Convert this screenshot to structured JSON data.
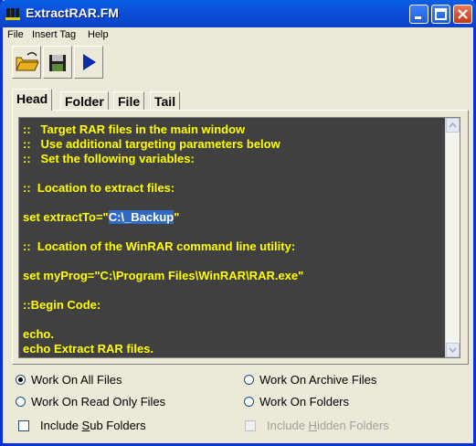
{
  "window": {
    "title": "ExtractRAR.FM"
  },
  "menu": [
    "File",
    "Insert Tag",
    "Help"
  ],
  "toolbar": {
    "icons": [
      "open-folder-icon",
      "save-disk-icon",
      "run-play-icon"
    ]
  },
  "tabs": [
    {
      "label": "Head",
      "active": true
    },
    {
      "label": "Folder",
      "active": false
    },
    {
      "label": "File",
      "active": false
    },
    {
      "label": "Tail",
      "active": false
    }
  ],
  "editor": {
    "lines": [
      "::   Target RAR files in the main window",
      "::   Use additional targeting parameters below",
      "::   Set the following variables:",
      "",
      "::  Location to extract files:",
      "",
      {
        "before": "set extractTo=\"",
        "selected": "C:\\_Backup",
        "after": "\""
      },
      "",
      "::  Location of the WinRAR command line utility:",
      "",
      "set myProg=\"C:\\Program Files\\WinRAR\\RAR.exe\"",
      "",
      "::Begin Code:",
      "",
      "echo.",
      "echo Extract RAR files."
    ]
  },
  "options": {
    "work_all": {
      "label": "Work On All Files",
      "checked": true
    },
    "work_archive": {
      "label": "Work On Archive Files",
      "checked": false
    },
    "work_readonly": {
      "label": "Work On Read Only Files",
      "checked": false
    },
    "work_folders": {
      "label": "Work On Folders",
      "checked": false
    },
    "include_sub": {
      "label_pre": "Include ",
      "label_u": "S",
      "label_post": "ub Folders",
      "checked": false
    },
    "include_hidden": {
      "label_pre": "Include ",
      "label_u": "H",
      "label_post": "idden Folders",
      "checked": false,
      "disabled": true
    }
  }
}
